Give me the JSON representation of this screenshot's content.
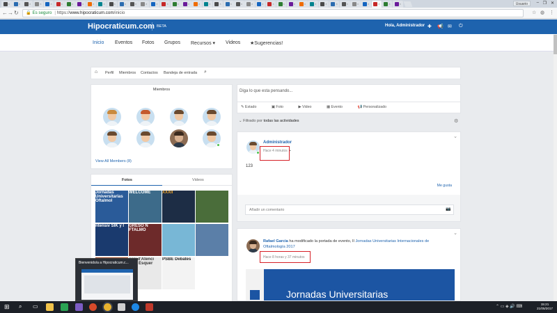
{
  "browser": {
    "tabs_count": 38,
    "user_label": "Usuario",
    "secure_label": "Es seguro",
    "url_prefix": "https://",
    "url_host": "www.hipocraticum.com",
    "url_path": "/inicio"
  },
  "site": {
    "logo": "Hipocraticum.com",
    "badge": "BETA",
    "greeting": "Hola, Administrador"
  },
  "nav": {
    "items": [
      "Inicio",
      "Eventos",
      "Fotos",
      "Grupos",
      "Recursos ▾",
      "Videos",
      "★Sugerencias!"
    ]
  },
  "subnav": {
    "items": [
      "Perfil",
      "Miembros",
      "Contactos",
      "Bandeja de entrada"
    ]
  },
  "members": {
    "title": "Miembros",
    "view_all": "View All Members (8)"
  },
  "media": {
    "tabs": [
      "Fotos",
      "Videos"
    ],
    "thumb_texts": [
      "Jornadas Universitarias Oftalmol",
      "WELCOME",
      "XXXII",
      "",
      "ntensiv SIK y I",
      "GRESO N FTALMO",
      "",
      "",
      "",
      "orci d'Atenci lona Esquer",
      "PSBE Debates",
      ""
    ]
  },
  "composer": {
    "placeholder": "Diga lo que esta pensando...",
    "actions": [
      "Estado",
      "Foto",
      "Video",
      "Evento",
      "Personalizado"
    ]
  },
  "filter": {
    "prefix": "Filtrado por",
    "value": "todas las actividades"
  },
  "post1": {
    "author": "Administrador",
    "time": "Hace 4 minutos",
    "body": "123",
    "like": "Me gusta",
    "comment_placeholder": "Añadir un comentario"
  },
  "post2": {
    "author": "Rafael Garcia",
    "action": "ha modificado la portada de evento, II",
    "event": "Jornadas Universitarias Internacionales de Oftalmología 2017",
    "time": "Hace 8 horas y 37 minutos",
    "banner_text": "Jornadas Universitarias"
  },
  "popup": {
    "title": "Bienvenido/a a Hipocraticum.c..."
  },
  "taskbar": {
    "time": "15:21",
    "date": "21/05/2017"
  },
  "colors": {
    "brand": "#1e63ae",
    "highlight": "#d61f26"
  }
}
